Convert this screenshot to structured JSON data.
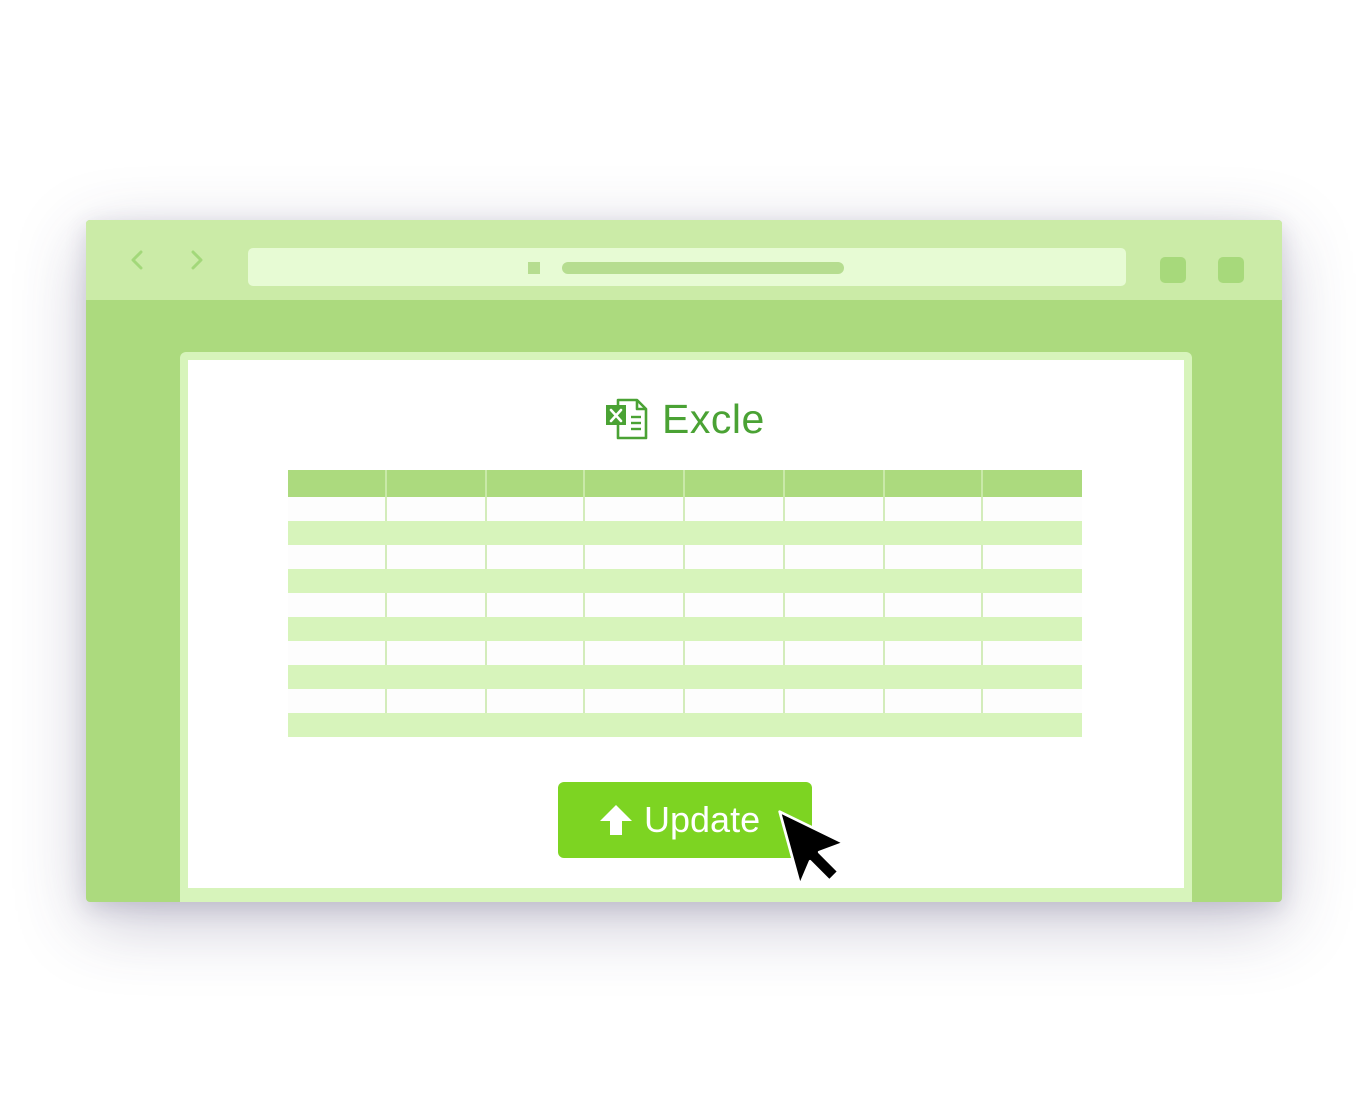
{
  "window": {
    "background_color": "#acda7e",
    "toolbar_color": "#cbeba7",
    "address_bar_color": "#e7fbd4"
  },
  "toolbar": {
    "back_icon": "chevron-left-icon",
    "forward_icon": "chevron-right-icon"
  },
  "document": {
    "icon": "excel-file-icon",
    "title": "Excle",
    "title_color": "#4aa234"
  },
  "sheet": {
    "columns": 8,
    "rows": 10,
    "header_color": "#acda7e",
    "stripe_color": "#d7f4bb"
  },
  "action": {
    "icon": "upload-arrow-icon",
    "label": "Update",
    "color": "#7dd422"
  },
  "pointer": {
    "icon": "mouse-pointer-icon"
  }
}
